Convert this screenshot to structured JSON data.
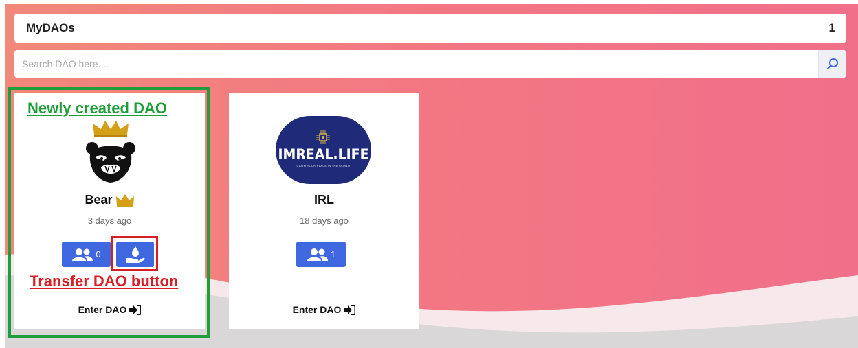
{
  "header": {
    "title": "MyDAOs",
    "count": "1"
  },
  "search": {
    "placeholder": "Search DAO here...."
  },
  "cards": [
    {
      "name": "Bear",
      "time": "3 days ago",
      "members": "0",
      "enter_label": "Enter DAO",
      "is_owner": true,
      "logo": "bear-crown-logo"
    },
    {
      "name": "IRL",
      "time": "18 days ago",
      "members": "1",
      "enter_label": "Enter DAO",
      "logo_text": "IMREAL.LIFE",
      "logo_tagline": "CLAIM YOUR PLACE IN THE WORLD"
    }
  ],
  "annotations": {
    "new_dao": "Newly created DAO",
    "transfer": "Transfer DAO button"
  },
  "colors": {
    "accent_blue": "#3f67e0",
    "background_pink": "#f0717f",
    "annotation_green": "#1f9d3a",
    "annotation_red": "#d61f26",
    "crown_gold": "#d4a017"
  }
}
